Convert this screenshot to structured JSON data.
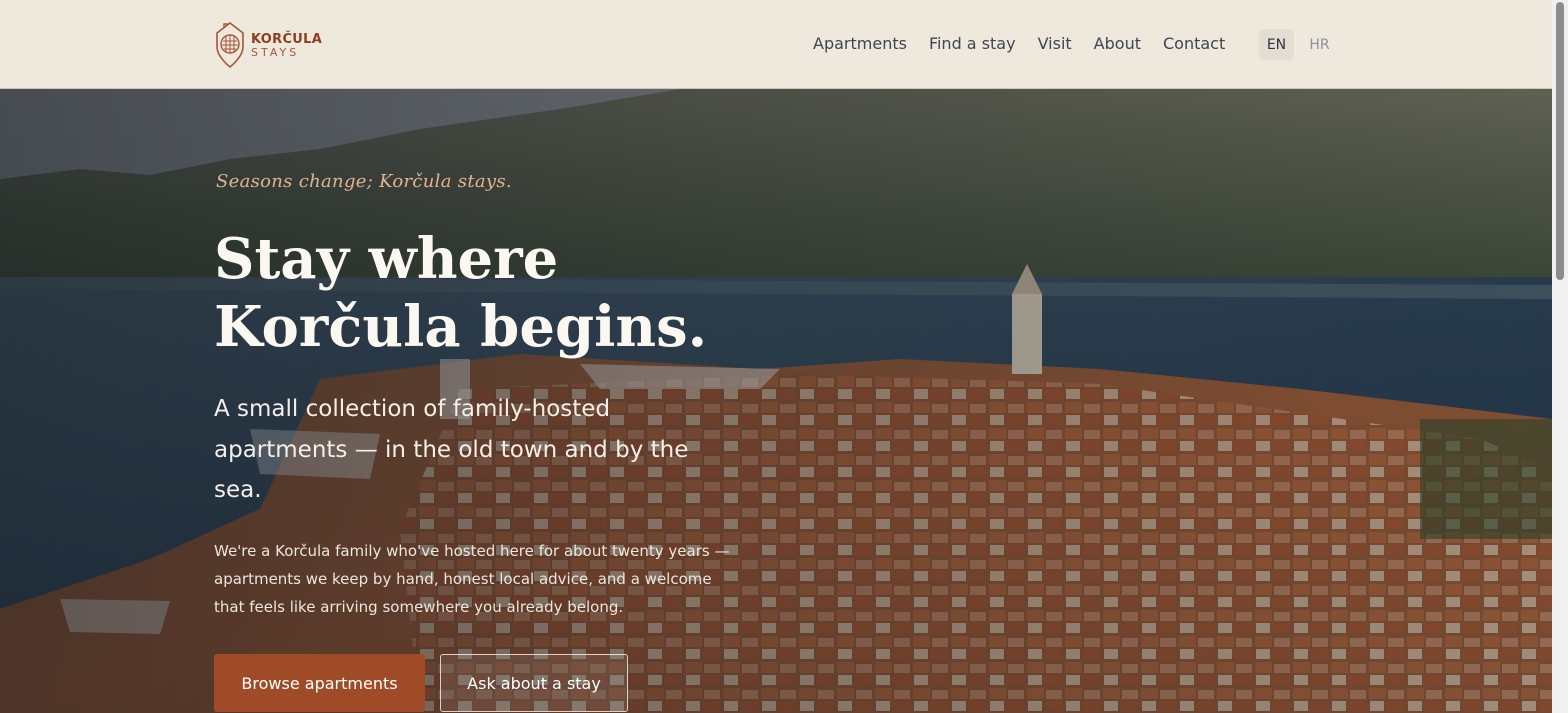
{
  "brand": {
    "name_line1": "KORČULA",
    "name_line2": "STAYS",
    "logo_icon": "house-pin-icon"
  },
  "nav": {
    "items": [
      {
        "label": "Apartments"
      },
      {
        "label": "Find a stay"
      },
      {
        "label": "Visit"
      },
      {
        "label": "About"
      },
      {
        "label": "Contact"
      }
    ]
  },
  "languages": {
    "selected": "EN",
    "other": "HR"
  },
  "hero": {
    "tagline": "Seasons change; Korčula stays.",
    "headline": "Stay where Korčula begins.",
    "subheadline": "A small collection of family-hosted apartments — in the old town and by the sea.",
    "body": "We're a Korčula family who've hosted here for about twenty years — apartments we keep by hand, honest local advice, and a welcome that feels like arriving somewhere you already belong.",
    "primary_button": "Browse apartments",
    "secondary_button": "Ask about a stay",
    "image": "aerial-korcula-old-town-photo"
  },
  "colors": {
    "header_bg": "#eee8dd",
    "brand_accent": "#a04b27",
    "tagline": "#e1b48f"
  }
}
